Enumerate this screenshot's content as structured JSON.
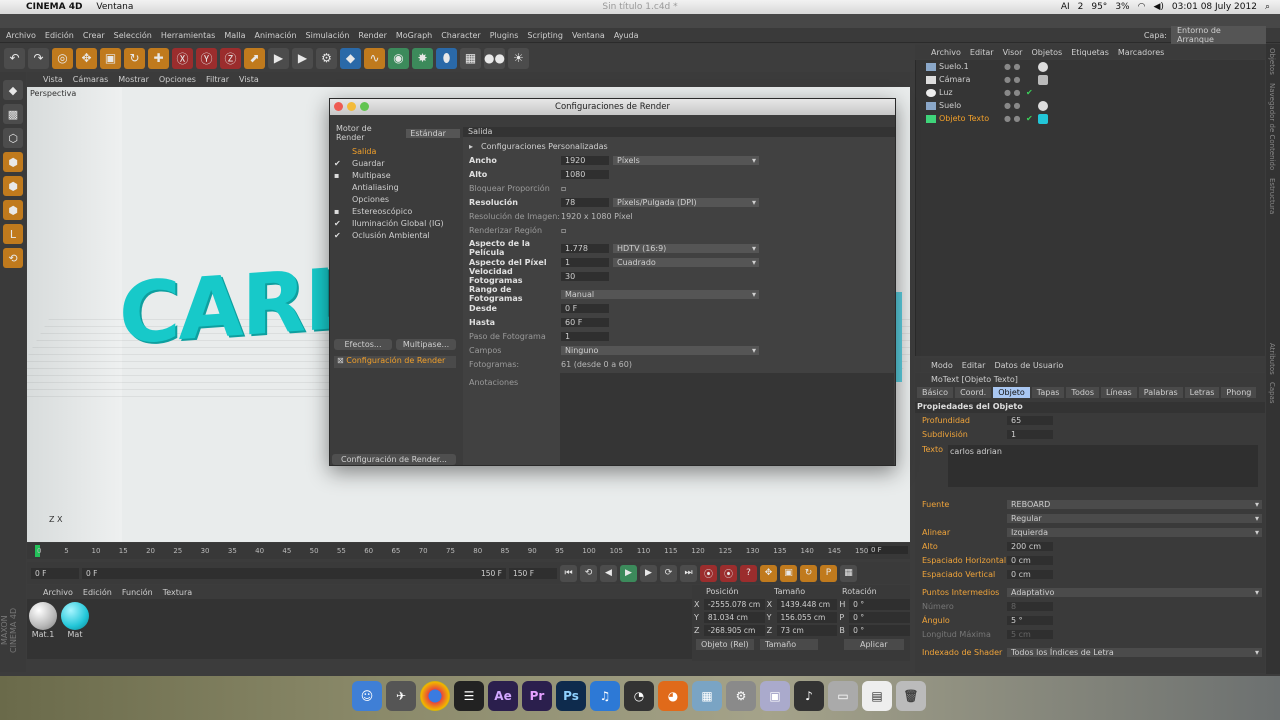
{
  "menubar": {
    "app": "CINEMA 4D",
    "menu": "Ventana",
    "doc_title": "Sin título 1.c4d *",
    "temp": "95°",
    "battery": "3%",
    "clock": "03:01 08 July 2012",
    "ai_label": "AI",
    "num": "2"
  },
  "c4dmenu": {
    "items": [
      "Archivo",
      "Edición",
      "Crear",
      "Selección",
      "Herramientas",
      "Malla",
      "Animación",
      "Simulación",
      "Render",
      "MoGraph",
      "Character",
      "Plugins",
      "Scripting",
      "Ventana",
      "Ayuda"
    ],
    "layout_label": "Capa:",
    "layout_value": "Entorno de Arranque"
  },
  "viewport": {
    "menu": [
      "Vista",
      "Cámaras",
      "Mostrar",
      "Opciones",
      "Filtrar",
      "Vista"
    ],
    "label": "Perspectiva",
    "text_object": "CARL",
    "axis": "Z  X"
  },
  "timeline": {
    "ticks": [
      "0",
      "5",
      "10",
      "15",
      "20",
      "25",
      "30",
      "35",
      "40",
      "45",
      "50",
      "55",
      "60",
      "65",
      "70",
      "75",
      "80",
      "85",
      "90",
      "95",
      "100",
      "105",
      "110",
      "115",
      "120",
      "125",
      "130",
      "135",
      "140",
      "145",
      "150"
    ],
    "current": "0 F",
    "start": "0 F",
    "start2": "0 F",
    "end": "150 F",
    "end2": "150 F"
  },
  "materials": {
    "menu": [
      "Archivo",
      "Edición",
      "Función",
      "Textura"
    ],
    "items": [
      {
        "name": "Mat.1",
        "color": "#d9d9d9"
      },
      {
        "name": "Mat",
        "color": "#22c6d8"
      }
    ],
    "brand": "MAXON CINEMA 4D"
  },
  "coords": {
    "headers": [
      "Posición",
      "Tamaño",
      "Rotación"
    ],
    "rows": [
      {
        "axis": "X",
        "pos": "-2555.078 cm",
        "size_axis": "X",
        "size": "1439.448 cm",
        "rot_axis": "H",
        "rot": "0 °"
      },
      {
        "axis": "Y",
        "pos": "81.034 cm",
        "size_axis": "Y",
        "size": "156.055 cm",
        "rot_axis": "P",
        "rot": "0 °"
      },
      {
        "axis": "Z",
        "pos": "-268.905 cm",
        "size_axis": "Z",
        "size": "73 cm",
        "rot_axis": "B",
        "rot": "0 °"
      }
    ],
    "mode": "Objeto (Rel)",
    "size_mode": "Tamaño",
    "apply": "Aplicar"
  },
  "objects": {
    "menu": [
      "Archivo",
      "Editar",
      "Visor",
      "Objetos",
      "Etiquetas",
      "Marcadores"
    ],
    "items": [
      {
        "name": "Suelo.1"
      },
      {
        "name": "Cámara"
      },
      {
        "name": "Luz"
      },
      {
        "name": "Suelo"
      },
      {
        "name": "Objeto Texto"
      }
    ]
  },
  "attributes": {
    "menu": [
      "Modo",
      "Editar",
      "Datos de Usuario"
    ],
    "object_name": "MoText [Objeto Texto]",
    "tabs": [
      "Básico",
      "Coord.",
      "Objeto",
      "Tapas",
      "Todos",
      "Líneas",
      "Palabras",
      "Letras",
      "Phong"
    ],
    "section": "Propiedades del Objeto",
    "profundidad_label": "Profundidad",
    "profundidad": "65",
    "subdivision_label": "Subdivisión",
    "subdivision": "1",
    "texto_label": "Texto",
    "texto": "carlos   adrian",
    "fuente_label": "Fuente",
    "fuente": "REBOARD",
    "fuente_style": "Regular",
    "alinear_label": "Alinear",
    "alinear": "Izquierda",
    "alto_label": "Alto",
    "alto": "200 cm",
    "esp_h_label": "Espaciado Horizontal",
    "esp_h": "0 cm",
    "esp_v_label": "Espaciado Vertical",
    "esp_v": "0 cm",
    "puntos_label": "Puntos Intermedios",
    "puntos": "Adaptativo",
    "numero_label": "Número",
    "numero": "8",
    "angulo_label": "Ángulo",
    "angulo": "5 °",
    "longitud_label": "Longitud Máxima",
    "longitud": "5 cm",
    "indexado_label": "Indexado de Shader",
    "indexado": "Todos los Índices de Letra"
  },
  "dialog": {
    "title": "Configuraciones de Render",
    "engine_label": "Motor de Render",
    "engine": "Estándar",
    "tree": [
      {
        "label": "Salida",
        "check": ""
      },
      {
        "label": "Guardar",
        "check": "✔"
      },
      {
        "label": "Multipase",
        "check": "▪"
      },
      {
        "label": "Antialiasing",
        "check": ""
      },
      {
        "label": "Opciones",
        "check": ""
      },
      {
        "label": "Estereoscópico",
        "check": "▪"
      },
      {
        "label": "Iluminación Global (IG)",
        "check": "✔"
      },
      {
        "label": "Oclusión Ambiental",
        "check": "✔"
      }
    ],
    "effects_btn": "Efectos...",
    "multipase_btn": "Multipase...",
    "config_item": "Configuración de Render",
    "config_btn": "Configuración de Render...",
    "section": "Salida",
    "preset": "Configuraciones Personalizadas",
    "ancho_label": "Ancho",
    "ancho": "1920",
    "units": "Píxels",
    "alto_label": "Alto",
    "alto": "1080",
    "bloquear_label": "Bloquear Proporción",
    "resolucion_label": "Resolución",
    "resolucion": "78",
    "res_units": "Píxels/Pulgada (DPI)",
    "res_imagen_label": "Resolución de Imagen:",
    "res_imagen": "1920 x 1080 Píxel",
    "renderizar_label": "Renderizar Región",
    "aspecto_pel_label": "Aspecto de la Película",
    "aspecto_pel": "1.778",
    "aspecto_pel_dd": "HDTV (16:9)",
    "aspecto_px_label": "Aspecto del Píxel",
    "aspecto_px": "1",
    "aspecto_px_dd": "Cuadrado",
    "vel_label": "Velocidad Fotogramas",
    "vel": "30",
    "rango_label": "Rango de Fotogramas",
    "rango": "Manual",
    "desde_label": "Desde",
    "desde": "0 F",
    "hasta_label": "Hasta",
    "hasta": "60 F",
    "paso_label": "Paso de Fotograma",
    "paso": "1",
    "campos_label": "Campos",
    "campos": "Ninguno",
    "fotogramas_label": "Fotogramas:",
    "fotogramas": "61 (desde 0 a 60)",
    "anotaciones_label": "Anotaciones"
  },
  "rstrip": [
    "Objetos",
    "Navegador de Contenido",
    "Estructura",
    "Atributos",
    "Capas"
  ],
  "dock": [
    "",
    "",
    "",
    "",
    "Ae",
    "Pr",
    "Ps",
    "",
    "",
    "",
    "",
    "",
    "",
    "",
    "",
    "",
    ""
  ]
}
